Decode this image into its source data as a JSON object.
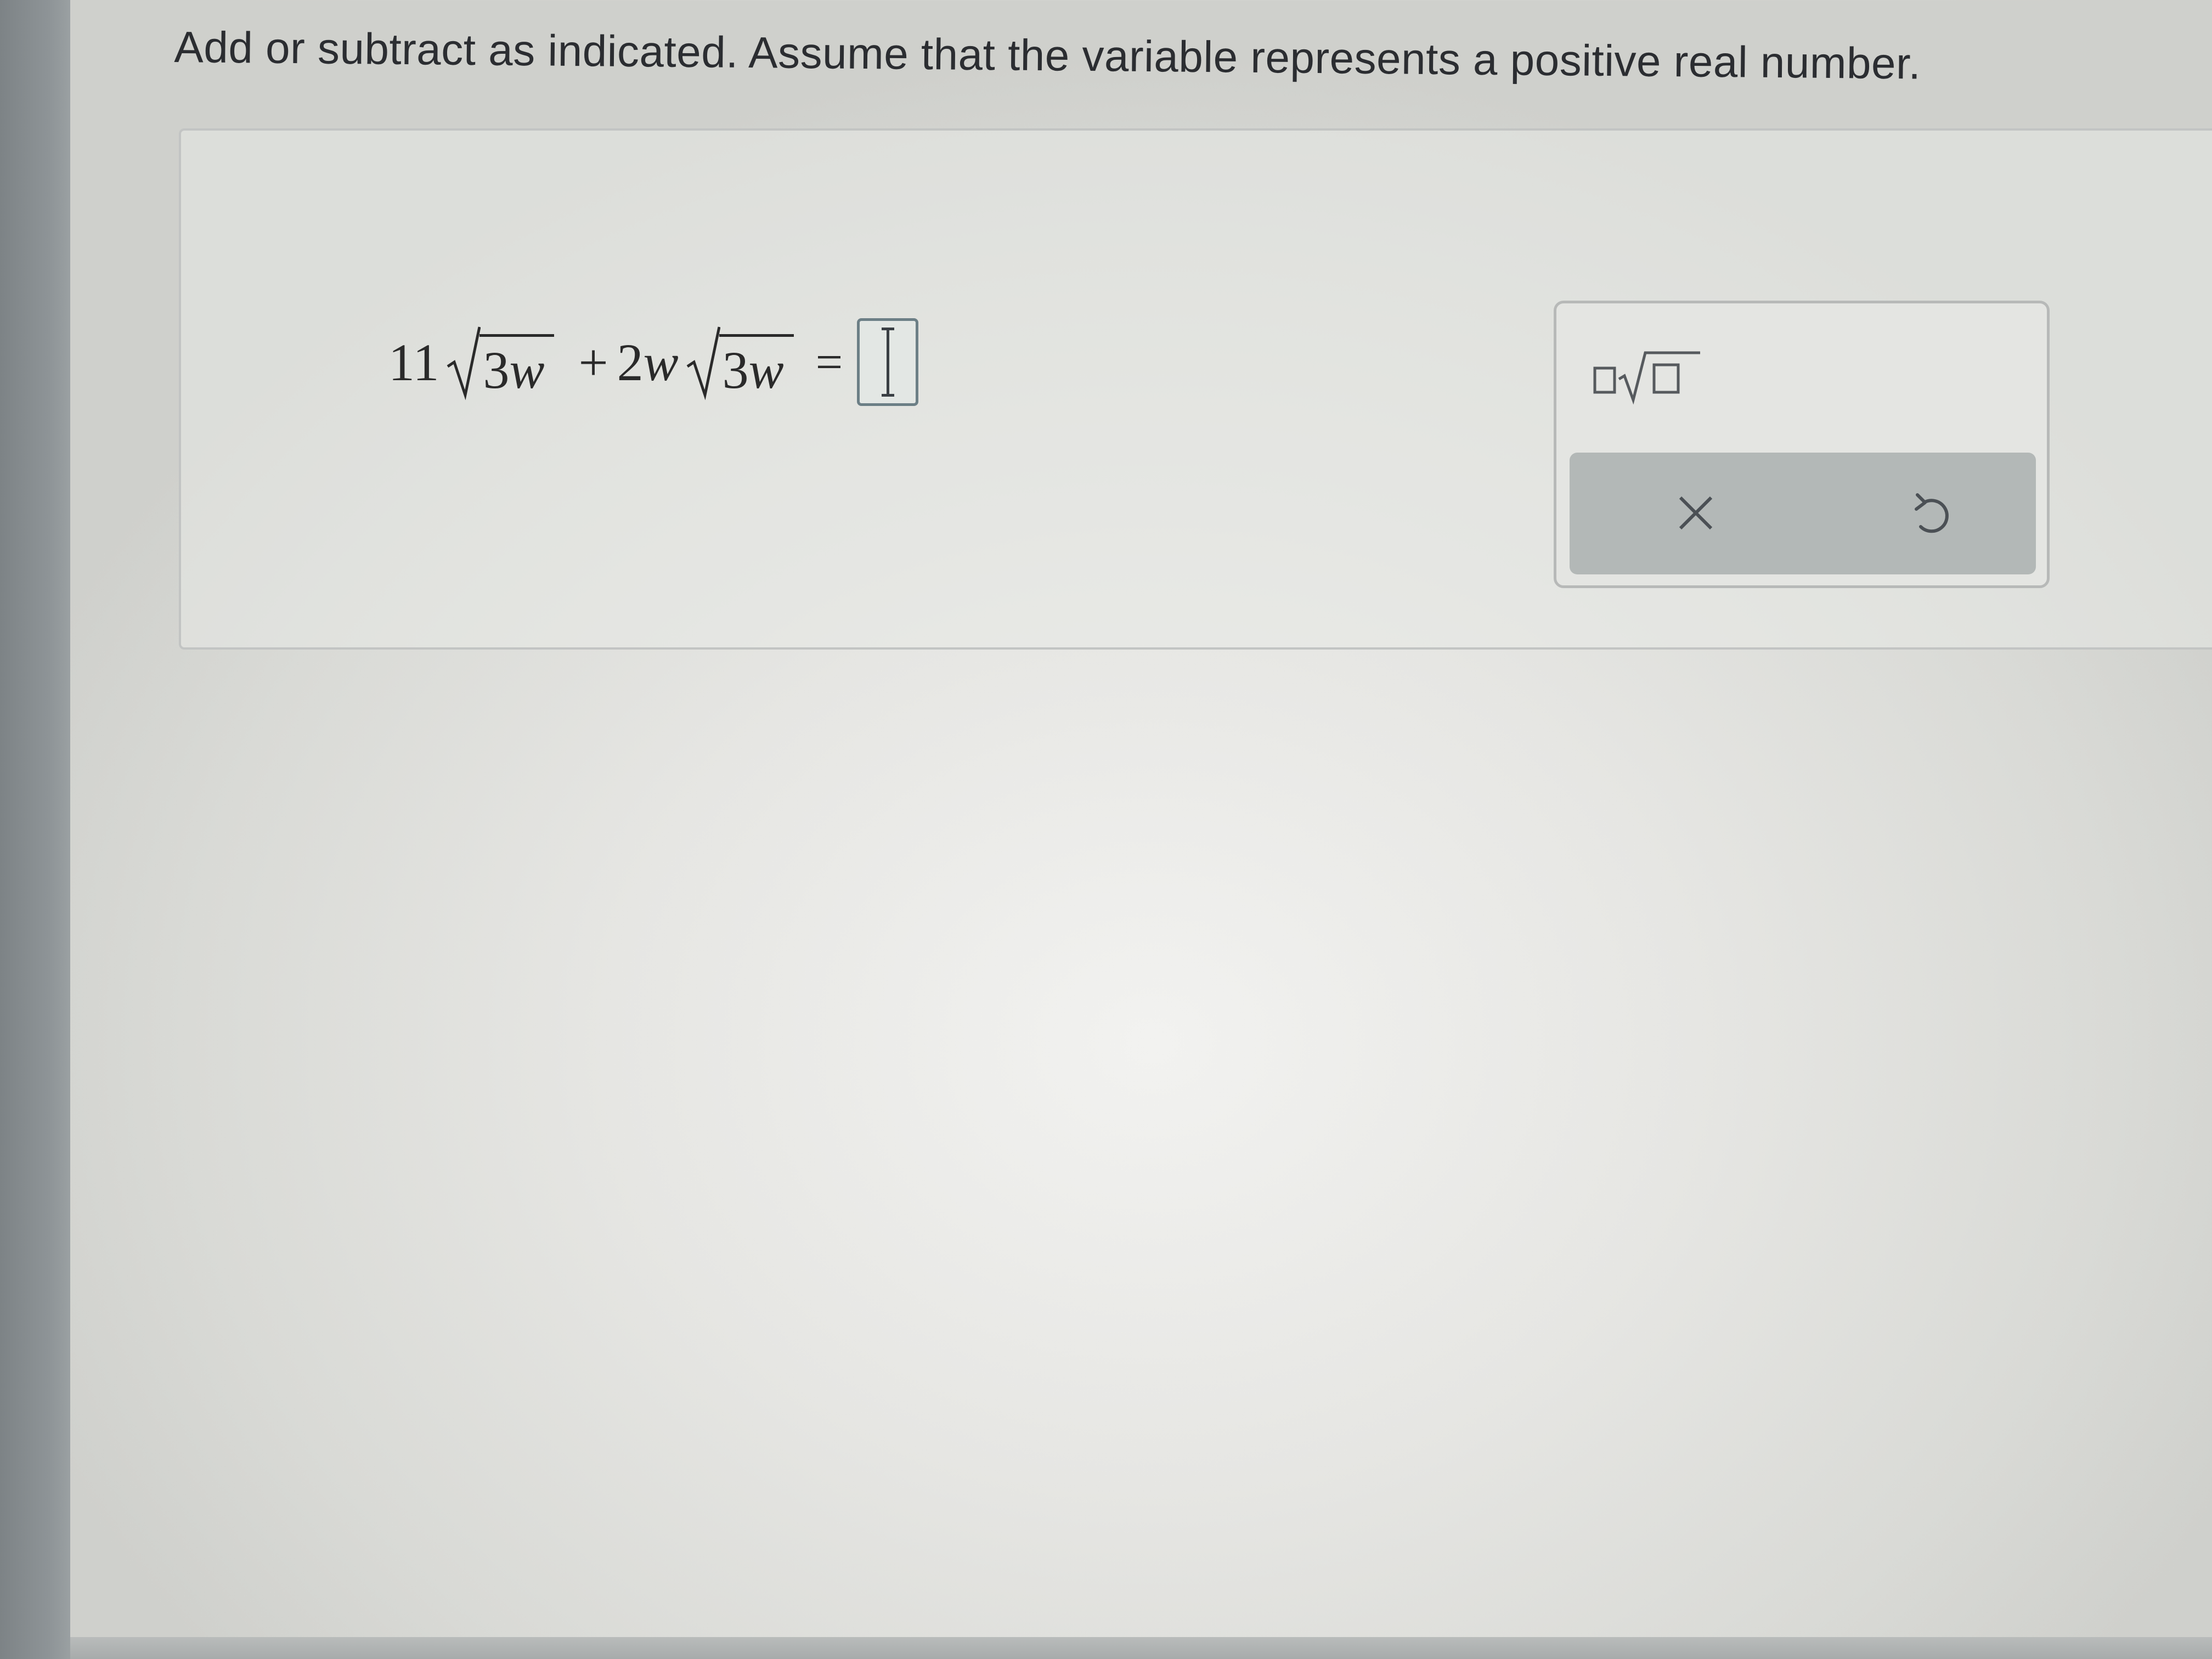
{
  "instructions": "Add or subtract as indicated. Assume that the variable represents a positive real number.",
  "expression": {
    "term1_coefficient": "11",
    "term1_radicand_number": "3",
    "term1_radicand_variable": "w",
    "operator": "+",
    "term2_coefficient_number": "2",
    "term2_coefficient_variable": "w",
    "term2_radicand_number": "3",
    "term2_radicand_variable": "w",
    "equals": "="
  },
  "answer": {
    "value": ""
  },
  "toolbar": {
    "template_icon": "box-times-sqrt-box-icon",
    "clear_icon": "close-icon",
    "undo_icon": "undo-icon"
  },
  "colors": {
    "text": "#2a2a2a",
    "answer_border": "#6c7f86",
    "action_bar": "#b3b8b7"
  }
}
